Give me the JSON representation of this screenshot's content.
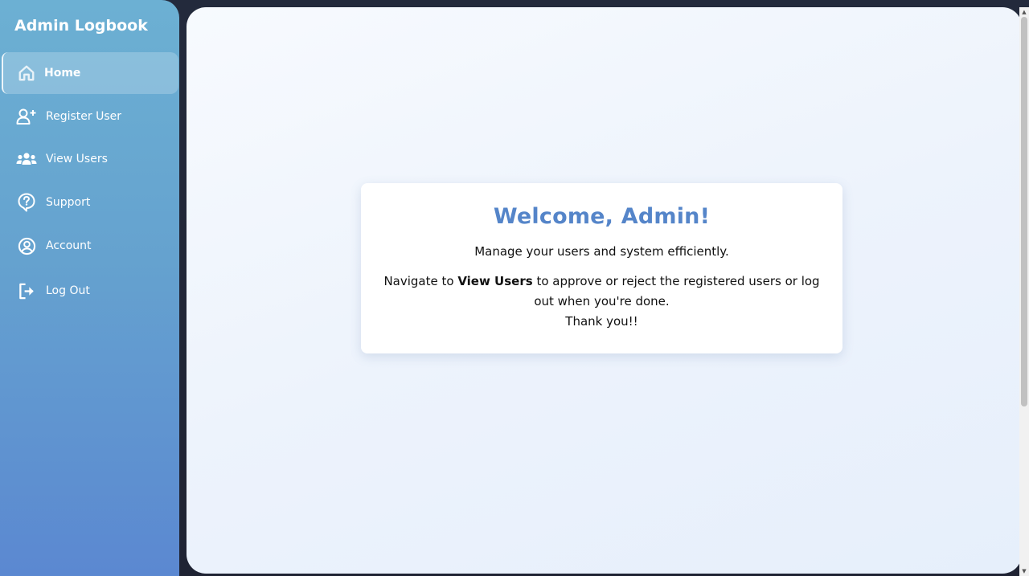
{
  "sidebar": {
    "brand": "Admin Logbook",
    "items": [
      {
        "label": "Home",
        "icon": "home-icon",
        "active": true
      },
      {
        "label": "Register User",
        "icon": "user-plus-icon",
        "active": false
      },
      {
        "label": "View Users",
        "icon": "users-icon",
        "active": false
      },
      {
        "label": "Support",
        "icon": "question-icon",
        "active": false
      },
      {
        "label": "Account",
        "icon": "user-circle-icon",
        "active": false
      },
      {
        "label": "Log Out",
        "icon": "logout-icon",
        "active": false
      }
    ]
  },
  "welcome": {
    "title": "Welcome, Admin!",
    "subtitle": "Manage your users and system efficiently.",
    "instruction_prefix": "Navigate to ",
    "instruction_bold": "View Users",
    "instruction_suffix": " to approve or reject the registered users or log out when you're done.",
    "thanks": "Thank you!!"
  },
  "colors": {
    "accent": "#5585c9",
    "sidebar_top": "#6cb0d3",
    "sidebar_bottom": "#5b88d1",
    "background": "#1f2333"
  }
}
